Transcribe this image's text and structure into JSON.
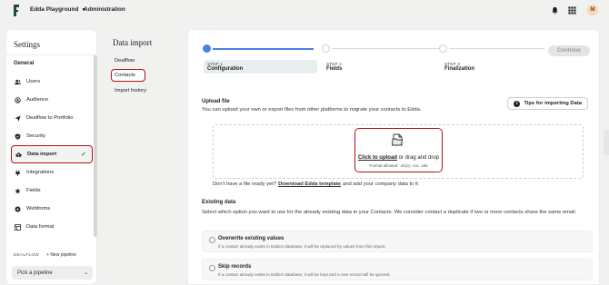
{
  "topbar": {
    "workspace": "Edda Playground",
    "section": "Administration",
    "user_initial": "M",
    "icons": [
      "bell-icon",
      "grid-icon"
    ]
  },
  "settings": {
    "title": "Settings",
    "group": "General",
    "items": [
      {
        "label": "Users",
        "icon": "users-icon"
      },
      {
        "label": "Audience",
        "icon": "audience-icon"
      },
      {
        "label": "Dealflow to Portfolio",
        "icon": "send-icon"
      },
      {
        "label": "Security",
        "icon": "shield-icon"
      },
      {
        "label": "Data import",
        "icon": "cloud-upload-icon",
        "active": true
      },
      {
        "label": "Integrations",
        "icon": "integrations-icon"
      },
      {
        "label": "Fields",
        "icon": "fields-icon"
      },
      {
        "label": "Webforms",
        "icon": "webforms-icon"
      },
      {
        "label": "Data format",
        "icon": "data-format-icon"
      }
    ],
    "pipeline_header": "DEALFLOW",
    "new_pipeline": "New pipeline",
    "pick_pipeline": "Pick a pipeline"
  },
  "data_import_nav": {
    "title": "Data import",
    "items": [
      {
        "label": "Dealflow"
      },
      {
        "label": "Contacts",
        "active": true
      },
      {
        "label": "Import history"
      }
    ]
  },
  "stepper": {
    "steps": [
      {
        "number": "STEP 1",
        "name": "Configuration",
        "active": true
      },
      {
        "number": "STEP 2",
        "name": "Fields"
      },
      {
        "number": "STEP 3",
        "name": "Finalization"
      }
    ],
    "continue_label": "Continue"
  },
  "upload": {
    "title": "Upload file",
    "description": "You can upload your own or export files from other platforms to migrate your contacts to Edda.",
    "tips_label": "Tips for importing Data",
    "click_label": "Click to upload",
    "drag_label": "or drag and drop",
    "format_label": "Format allowed: .xls(x) .csv .ods",
    "template_prefix": "Don't have a file ready yet?",
    "template_link": "Download Edda template",
    "template_suffix": "and add your company data to it"
  },
  "existing": {
    "title": "Existing data",
    "description": "Select which option you want to use for the already existing data in your Contacts. We consider contact a duplicate if two or more contacts share the same email.",
    "options": [
      {
        "title": "Overwrite existing values",
        "desc": "If a contact already exists in Edda's database, it will be replaced by values from this import."
      },
      {
        "title": "Skip records",
        "desc": "If a contact already exists in Edda's database, it will be kept and a new record will be ignored."
      }
    ]
  },
  "colors": {
    "accent": "#4a80e8",
    "highlight": "#b3121a",
    "success": "#3b8a3e"
  }
}
